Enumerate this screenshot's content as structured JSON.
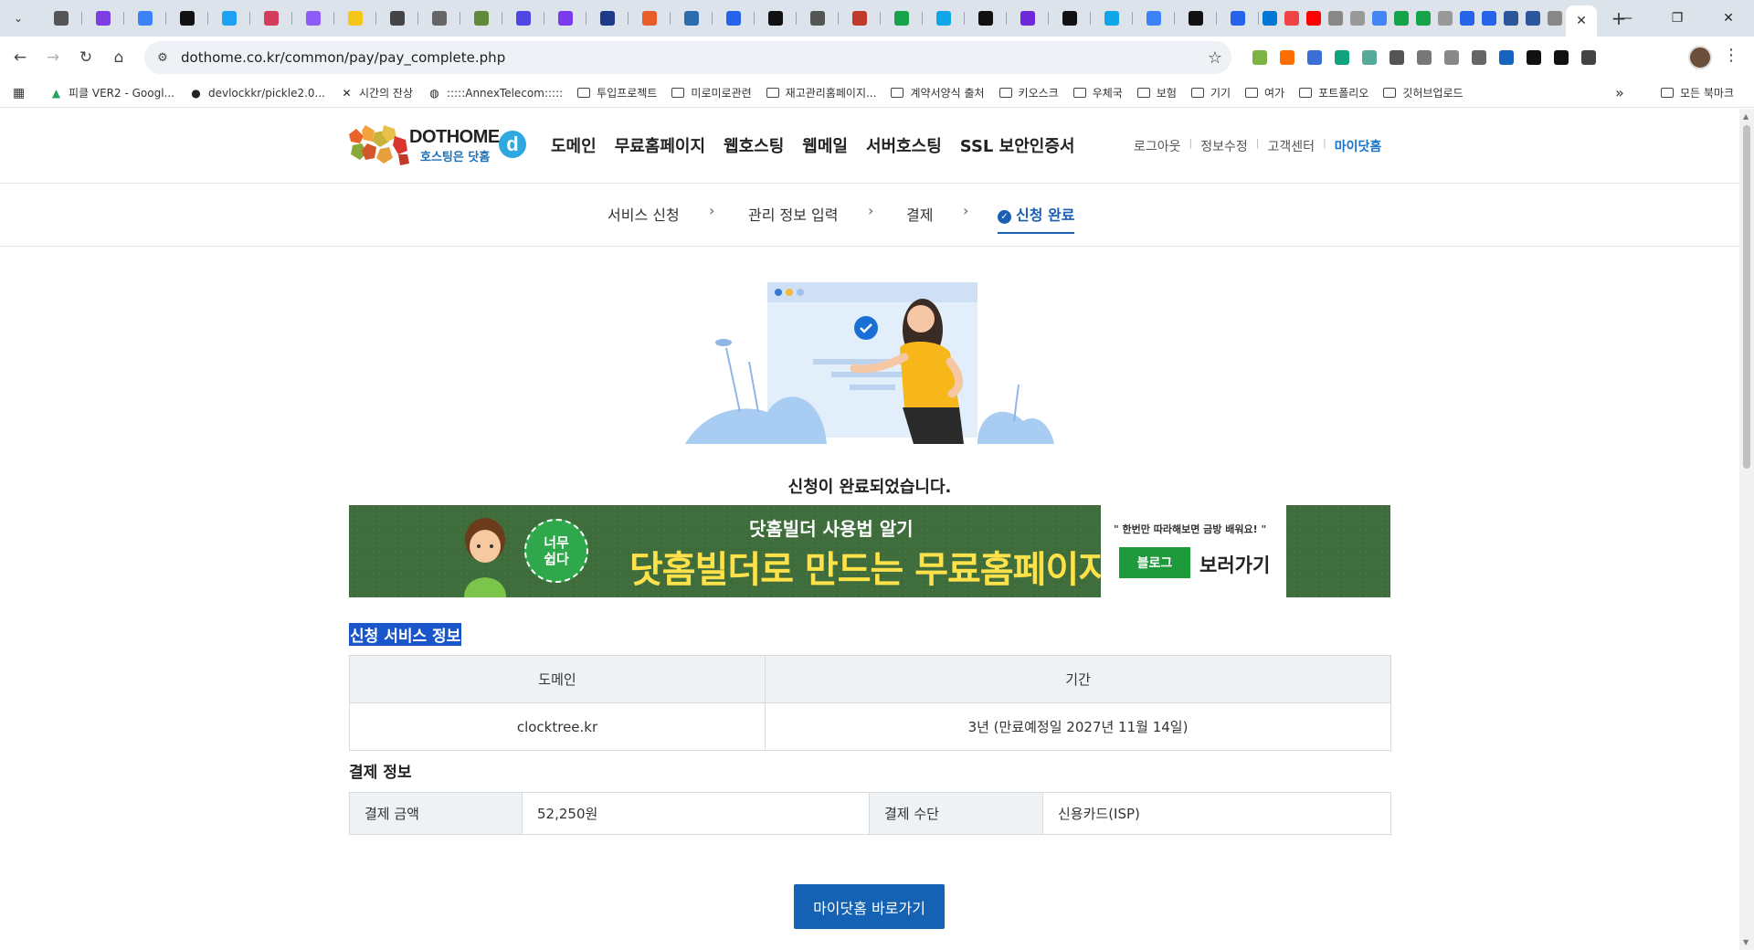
{
  "browser": {
    "url": "dothome.co.kr/common/pay/pay_complete.php",
    "tab_favicon_colors": [
      "#555",
      "#7b3fe4",
      "#3b82f6",
      "#111",
      "#1da1f2",
      "#d63c5e",
      "#8b5cf6",
      "#f5c518",
      "#444",
      "#666",
      "#5f8a3a",
      "#4f46e5",
      "#7c3aed",
      "#1e3a8a",
      "#e85d2a",
      "#2b6cb0",
      "#2563eb",
      "#111",
      "#555",
      "#c0392b",
      "#16a34a",
      "#0ea5e9",
      "#111",
      "#6d28d9",
      "#111",
      "#0ea5e9",
      "#3b82f6",
      "#111",
      "#2563eb"
    ],
    "tab_small_colors": [
      "#0078d4",
      "#e44",
      "#f00",
      "#888",
      "#999",
      "#4285f4",
      "#16a34a",
      "#16a34a",
      "#999",
      "#2563eb",
      "#2563eb",
      "#2b579a",
      "#2b579a",
      "#888"
    ],
    "extension_colors": [
      "#7cb342",
      "#ff6d00",
      "#3b6fd8",
      "#10a37f",
      "#5a9",
      "#555",
      "#777",
      "#888",
      "#666",
      "#1565c0",
      "#111",
      "#111",
      "#444"
    ],
    "bookmarks": [
      {
        "label": "피클 VER2 - Googl...",
        "icon": "drive-icon"
      },
      {
        "label": "devlockkr/pickle2.0...",
        "icon": "github-icon"
      },
      {
        "label": "시간의 잔상",
        "icon": "x-logo-icon"
      },
      {
        "label": ":::::AnnexTelecom:::::",
        "icon": "globe-icon"
      },
      {
        "label": "투입프로젝트",
        "icon": "folder-icon"
      },
      {
        "label": "미로미로관련",
        "icon": "folder-icon"
      },
      {
        "label": "재고관리홈페이지...",
        "icon": "folder-icon"
      },
      {
        "label": "계약서양식 출처",
        "icon": "folder-icon"
      },
      {
        "label": "키오스크",
        "icon": "folder-icon"
      },
      {
        "label": "우체국",
        "icon": "folder-icon"
      },
      {
        "label": "보험",
        "icon": "folder-icon"
      },
      {
        "label": "기기",
        "icon": "folder-icon"
      },
      {
        "label": "여가",
        "icon": "folder-icon"
      },
      {
        "label": "포트폴리오",
        "icon": "folder-icon"
      },
      {
        "label": "깃허브업로드",
        "icon": "folder-icon"
      }
    ],
    "bookmarks_all": "모든 북마크"
  },
  "header": {
    "logo_brand": "DOTHOME",
    "logo_sub": "호스팅은 닷홈",
    "logo_mark": "d",
    "nav": [
      "도메인",
      "무료홈페이지",
      "웹호스팅",
      "웹메일",
      "서버호스팅",
      "SSL 보안인증서"
    ],
    "util": [
      "로그아웃",
      "정보수정",
      "고객센터",
      "마이닷홈"
    ]
  },
  "steps": {
    "items": [
      "서비스 신청",
      "관리 정보 입력",
      "결제",
      "신청 완료"
    ],
    "active_index": 3
  },
  "main": {
    "complete_message": "신청이 완료되었습니다."
  },
  "banner": {
    "badge_line1": "너무",
    "badge_line2": "쉽다",
    "subtitle": "닷홈빌더 사용법 알기",
    "title": "닷홈빌더로 만드는 무료홈페이지!",
    "quote": "\" 한번만 따라해보면 금방 배워요! \"",
    "blog_label": "블로그",
    "go_label": "보러가기"
  },
  "service_info": {
    "title": "신청 서비스 정보",
    "columns": [
      "도메인",
      "기간"
    ],
    "rows": [
      [
        "clocktree.kr",
        "3년 (만료예정일 2027년 11월 14일)"
      ]
    ]
  },
  "payment_info": {
    "title": "결제 정보",
    "amount_label": "결제 금액",
    "amount_value": "52,250원",
    "method_label": "결제 수단",
    "method_value": "신용카드(ISP)"
  },
  "my_dothome_button": "마이닷홈 바로가기"
}
